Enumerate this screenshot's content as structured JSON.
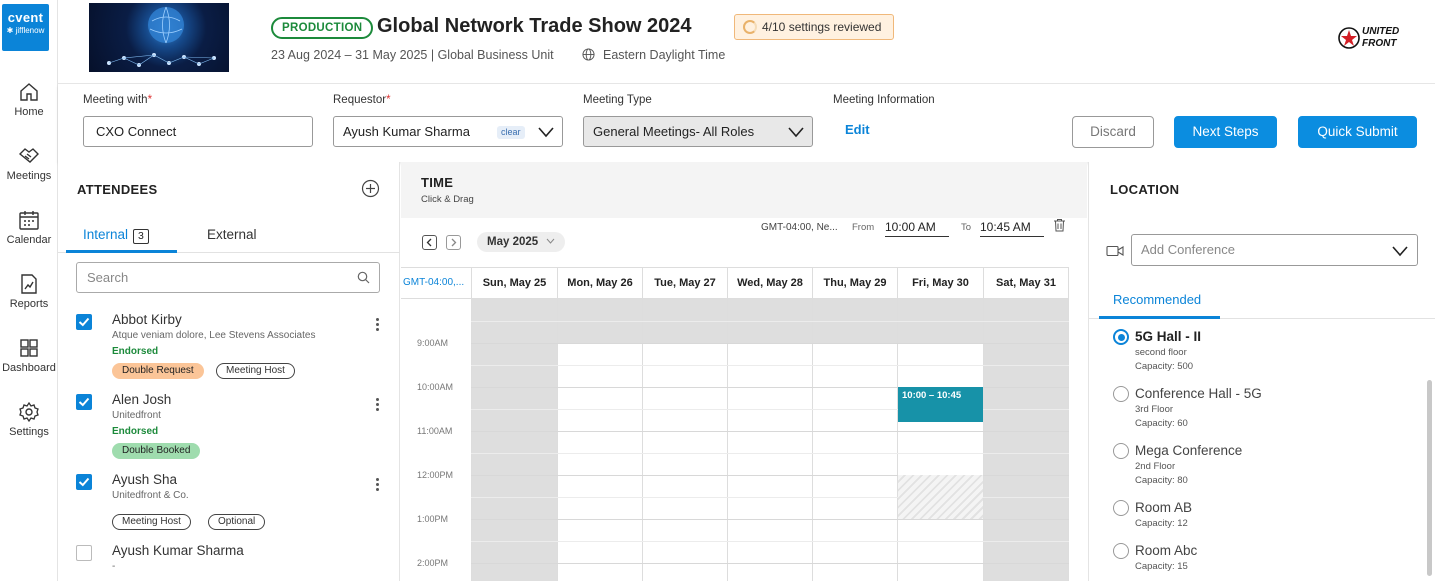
{
  "brand": {
    "logo_line1": "cvent",
    "logo_line2": "✱ jifflenow",
    "partner_logo_line1": "UNITED",
    "partner_logo_line2": "FRONT"
  },
  "nav": [
    {
      "label": "Home",
      "icon": "home-icon"
    },
    {
      "label": "Meetings",
      "icon": "handshake-icon"
    },
    {
      "label": "Calendar",
      "icon": "calendar-icon"
    },
    {
      "label": "Reports",
      "icon": "reports-icon"
    },
    {
      "label": "Dashboard",
      "icon": "dashboard-icon"
    },
    {
      "label": "Settings",
      "icon": "gear-icon"
    }
  ],
  "event": {
    "status": "PRODUCTION",
    "title": "Global Network Trade Show 2024",
    "settings_reviewed": "4/10 settings reviewed",
    "dates": "23 Aug 2024 – 31 May 2025 | Global Business Unit",
    "timezone": "Eastern Daylight Time"
  },
  "form": {
    "meeting_with_label": "Meeting with",
    "meeting_with_value": "CXO Connect",
    "requestor_label": "Requestor",
    "requestor_value": "Ayush Kumar Sharma",
    "requestor_clear": "clear",
    "meeting_type_label": "Meeting Type",
    "meeting_type_value": "General Meetings- All Roles",
    "meeting_info_label": "Meeting Information",
    "edit_label": "Edit",
    "required_mark": "*"
  },
  "actions": {
    "discard": "Discard",
    "next_steps": "Next Steps",
    "quick_submit": "Quick Submit"
  },
  "attendees": {
    "title": "ATTENDEES",
    "tab_internal": "Internal",
    "internal_count": "3",
    "tab_external": "External",
    "search_placeholder": "Search",
    "list": [
      {
        "name": "Abbot Kirby",
        "org": "Atque veniam dolore, Lee Stevens Associates",
        "status": "Endorsed",
        "tags": [
          "Double Request",
          "Meeting Host"
        ],
        "checked": true
      },
      {
        "name": "Alen Josh",
        "org": "Unitedfront",
        "status": "Endorsed",
        "tags": [
          "Double Booked"
        ],
        "checked": true
      },
      {
        "name": "Ayush Sha",
        "org": "Unitedfront & Co.",
        "status": "",
        "tags": [
          "Meeting Host",
          "Optional"
        ],
        "checked": true
      },
      {
        "name": "Ayush Kumar Sharma",
        "org": "-",
        "status": "",
        "tags": [],
        "checked": false
      }
    ]
  },
  "time": {
    "title": "TIME",
    "subtitle": "Click & Drag",
    "month": "May 2025",
    "tz_short": "GMT-04:00, Ne...",
    "from_label": "From",
    "from_value": "10:00 AM",
    "to_label": "To",
    "to_value": "10:45 AM",
    "gmt_col": "GMT-04:00,...",
    "days": [
      "Sun, May 25",
      "Mon, May 26",
      "Tue, May 27",
      "Wed, May 28",
      "Thu, May 29",
      "Fri, May 30",
      "Sat, May 31"
    ],
    "hours": [
      "9:00AM",
      "10:00AM",
      "11:00AM",
      "12:00PM",
      "1:00PM",
      "2:00PM"
    ],
    "event_label": "10:00 – 10:45"
  },
  "location": {
    "title": "LOCATION",
    "conference_placeholder": "Add Conference",
    "tab_recommended": "Recommended",
    "rooms": [
      {
        "name": "5G Hall - II",
        "floor": "second floor",
        "capacity": "Capacity: 500",
        "selected": true
      },
      {
        "name": "Conference Hall - 5G",
        "floor": "3rd Floor",
        "capacity": "Capacity: 60",
        "selected": false
      },
      {
        "name": "Mega Conference",
        "floor": "2nd Floor",
        "capacity": "Capacity: 80",
        "selected": false
      },
      {
        "name": "Room AB",
        "floor": "",
        "capacity": "Capacity: 12",
        "selected": false
      },
      {
        "name": "Room Abc",
        "floor": "",
        "capacity": "Capacity: 15",
        "selected": false
      }
    ]
  },
  "colors": {
    "accent": "#0b8de0",
    "production": "#1c8a3b",
    "event_block": "#1792a8"
  }
}
